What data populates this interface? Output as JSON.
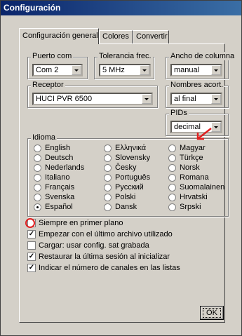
{
  "window": {
    "title": "Configuración"
  },
  "tabs": [
    {
      "label": "Configuración general",
      "active": true
    },
    {
      "label": "Colores",
      "active": false
    },
    {
      "label": "Convertir",
      "active": false
    }
  ],
  "puerto_com": {
    "legend": "Puerto com",
    "value": "Com 2"
  },
  "tolerancia": {
    "legend": "Tolerancia frec.",
    "value": "5 MHz"
  },
  "ancho": {
    "legend": "Ancho de columna",
    "value": "manual"
  },
  "receptor": {
    "legend": "Receptor",
    "value": "HUCI PVR 6500"
  },
  "nombres": {
    "legend": "Nombres acort.",
    "value": "al final"
  },
  "pids": {
    "legend": "PIDs",
    "value": "decimal"
  },
  "idioma": {
    "legend": "Idioma",
    "col1": [
      "English",
      "Deutsch",
      "Nederlands",
      "Italiano",
      "Français",
      "Svenska",
      "Español"
    ],
    "col2": [
      "Ελληνικά",
      "Slovensky",
      "Česky",
      "Português",
      "Русский",
      "Polski",
      "Dansk"
    ],
    "col3": [
      "Magyar",
      "Türkçe",
      "Norsk",
      "Romana",
      "Suomalainen",
      "Hrvatski",
      "Srpski"
    ],
    "selected": "Español"
  },
  "options": [
    {
      "label": "Siempre en primer plano",
      "checked": false
    },
    {
      "label": "Empezar con el último archivo utilizado",
      "checked": true
    },
    {
      "label": "Cargar: usar config. sat grabada",
      "checked": false
    },
    {
      "label": "Restaurar la última sesión al inicializar",
      "checked": true
    },
    {
      "label": "Indicar el número de canales en las listas",
      "checked": true
    }
  ],
  "ok_label": "OK",
  "annotation_color": "#e02020"
}
